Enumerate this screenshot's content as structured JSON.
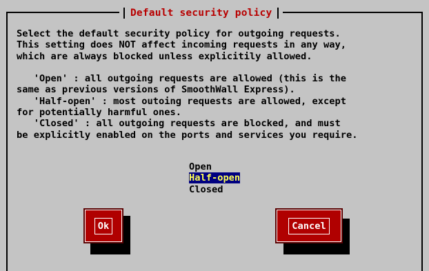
{
  "dialog": {
    "title": "Default security policy",
    "description_lines": [
      "Select the default security policy for outgoing requests.",
      "This setting does NOT affect incoming requests in any way,",
      "which are always blocked unless explicitily allowed.",
      "",
      "   'Open' : all outgoing requests are allowed (this is the",
      "same as previous versions of SmoothWall Express).",
      "   'Half-open' : most outoing requests are allowed, except",
      "for potentially harmful ones.",
      "   'Closed' : all outgoing requests are blocked, and must",
      "be explicitly enabled on the ports and services you require."
    ],
    "options": [
      {
        "label": "Open",
        "selected": false
      },
      {
        "label": "Half-open",
        "selected": true
      },
      {
        "label": "Closed",
        "selected": false
      }
    ],
    "buttons": {
      "ok_label": "Ok",
      "cancel_label": "Cancel"
    }
  },
  "colors": {
    "background": "#c4c4c4",
    "title_text": "#b80000",
    "button_fill": "#b00000",
    "button_text": "#ffffff",
    "selection_bg": "#000080",
    "selection_text": "#ffff55"
  }
}
